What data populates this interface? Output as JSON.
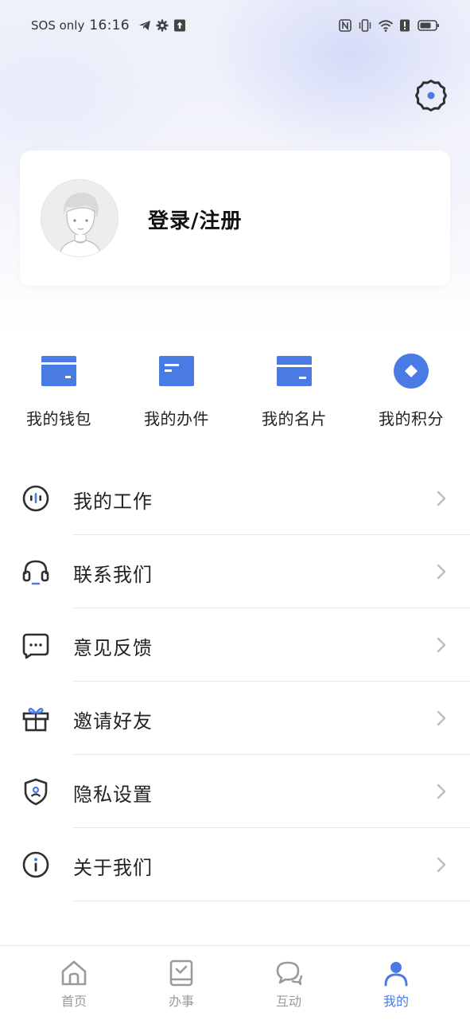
{
  "status_bar": {
    "carrier": "SOS only",
    "time": "16:16",
    "left_icons": [
      "telegram-icon",
      "gear-icon",
      "upload-icon"
    ],
    "right_icons": [
      "nfc-icon",
      "vibrate-icon",
      "wifi-icon",
      "alert-icon",
      "battery-icon"
    ]
  },
  "header": {
    "settings_icon": "gear-icon"
  },
  "profile": {
    "login_label": "登录/注册",
    "avatar_icon": "avatar-placeholder-icon"
  },
  "quick_actions": [
    {
      "label": "我的钱包",
      "icon": "wallet-icon"
    },
    {
      "label": "我的办件",
      "icon": "document-icon"
    },
    {
      "label": "我的名片",
      "icon": "card-icon"
    },
    {
      "label": "我的积分",
      "icon": "points-icon"
    }
  ],
  "menu": [
    {
      "label": "我的工作",
      "icon": "work-icon"
    },
    {
      "label": "联系我们",
      "icon": "headset-icon"
    },
    {
      "label": "意见反馈",
      "icon": "feedback-icon"
    },
    {
      "label": "邀请好友",
      "icon": "gift-icon"
    },
    {
      "label": "隐私设置",
      "icon": "shield-icon"
    },
    {
      "label": "关于我们",
      "icon": "info-icon"
    }
  ],
  "bottom_nav": [
    {
      "label": "首页",
      "icon": "home-icon",
      "active": false
    },
    {
      "label": "办事",
      "icon": "tasks-icon",
      "active": false
    },
    {
      "label": "互动",
      "icon": "chat-icon",
      "active": false
    },
    {
      "label": "我的",
      "icon": "user-icon",
      "active": true
    }
  ],
  "colors": {
    "accent": "#4a7be4",
    "text": "#222222",
    "inactive": "#9a9a9a",
    "divider": "#e9e9e9"
  }
}
